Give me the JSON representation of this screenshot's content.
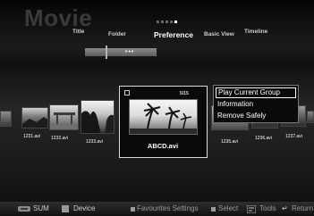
{
  "header": {
    "title": "Movie",
    "tabs": [
      {
        "label": "Title"
      },
      {
        "label": "Folder"
      },
      {
        "label": "Preference"
      },
      {
        "label": "Basic View"
      },
      {
        "label": "Timeline"
      }
    ]
  },
  "sort_bar": {
    "text": "•••"
  },
  "thumbnails": [
    {
      "label": "1231.avi"
    },
    {
      "label": "1232.avi"
    },
    {
      "label": "1233.avi"
    },
    {
      "label": "1235.avi"
    },
    {
      "label": "1236.avi"
    },
    {
      "label": "1237.avi"
    }
  ],
  "focused_item": {
    "name": "ABCD.avi",
    "counter": "5/15"
  },
  "tools_menu": {
    "items": [
      {
        "label": "Play Current Group"
      },
      {
        "label": "Information"
      },
      {
        "label": "Remove Safely"
      }
    ]
  },
  "bottom_bar": {
    "sum": "SUM",
    "device": "Device",
    "favourites": "Favourites Settings",
    "select": "Select",
    "tools": "Tools",
    "return": "Return"
  }
}
